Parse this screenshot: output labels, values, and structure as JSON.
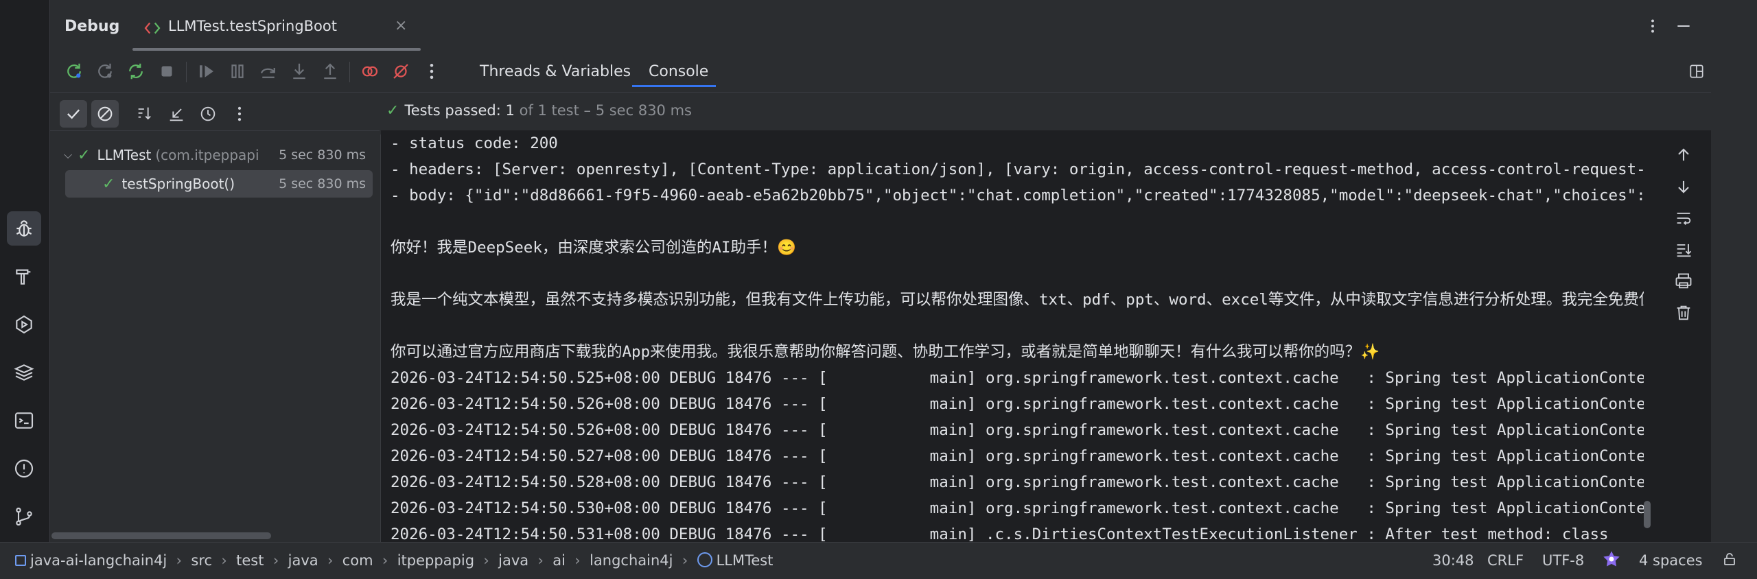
{
  "window": {
    "title": "Debug",
    "session_tab": "LLMTest.testSpringBoot",
    "session_tab_close": "×"
  },
  "view_tabs": [
    {
      "label": "Threads & Variables",
      "active": false
    },
    {
      "label": "Console",
      "active": true
    }
  ],
  "test_status": {
    "passed_label": "Tests passed:",
    "passed_count": "1",
    "detail": "of 1 test – 5 sec 830 ms"
  },
  "test_tree": [
    {
      "name": "LLMTest",
      "package": "(com.itpeppapi",
      "duration": "5 sec 830 ms",
      "selected": false,
      "expanded": true
    },
    {
      "name": "testSpringBoot()",
      "package": "",
      "duration": "5 sec 830 ms",
      "selected": true
    }
  ],
  "console_lines": [
    "- status code: 200",
    "- headers: [Server: openresty], [Content-Type: application/json], [vary: origin, access-control-request-method, access-control-request-headers]",
    "- body: {\"id\":\"d8d86661-f9f5-4960-aeab-e5a62b20bb75\",\"object\":\"chat.completion\",\"created\":1774328085,\"model\":\"deepseek-chat\",\"choices\":[{",
    "",
    "你好！我是DeepSeek，由深度求索公司创造的AI助手！😊",
    "",
    "我是一个纯文本模型，虽然不支持多模态识别功能，但我有文件上传功能，可以帮你处理图像、txt、pdf、ppt、word、excel等文件，从中读取文字信息进行分析处理。我完全免费使用，",
    "",
    "你可以通过官方应用商店下载我的App来使用我。我很乐意帮助你解答问题、协助工作学习，或者就是简单地聊聊天！有什么我可以帮你的吗？✨",
    "2026-03-24T12:54:50.525+08:00 DEBUG 18476 --- [           main] org.springframework.test.context.cache   : Spring test ApplicationContext cache",
    "2026-03-24T12:54:50.526+08:00 DEBUG 18476 --- [           main] org.springframework.test.context.cache   : Spring test ApplicationContext cache",
    "2026-03-24T12:54:50.526+08:00 DEBUG 18476 --- [           main] org.springframework.test.context.cache   : Spring test ApplicationContext cache",
    "2026-03-24T12:54:50.527+08:00 DEBUG 18476 --- [           main] org.springframework.test.context.cache   : Spring test ApplicationContext cache",
    "2026-03-24T12:54:50.528+08:00 DEBUG 18476 --- [           main] org.springframework.test.context.cache   : Spring test ApplicationContext cache",
    "2026-03-24T12:54:50.530+08:00 DEBUG 18476 --- [           main] org.springframework.test.context.cache   : Spring test ApplicationContext cache",
    "2026-03-24T12:54:50.531+08:00 DEBUG 18476 --- [           main] .c.s.DirtiesContextTestExecutionListener : After test method: class"
  ],
  "breadcrumb": [
    "java-ai-langchain4j",
    "src",
    "test",
    "java",
    "com",
    "itpeppapig",
    "java",
    "ai",
    "langchain4j",
    "LLMTest"
  ],
  "status_bar": {
    "position": "30:48",
    "line_ending": "CRLF",
    "encoding": "UTF-8",
    "indent": "4 spaces"
  },
  "colors": {
    "pass": "#5fb865",
    "accent": "#3574f0",
    "debug_stop": "#e05555"
  }
}
